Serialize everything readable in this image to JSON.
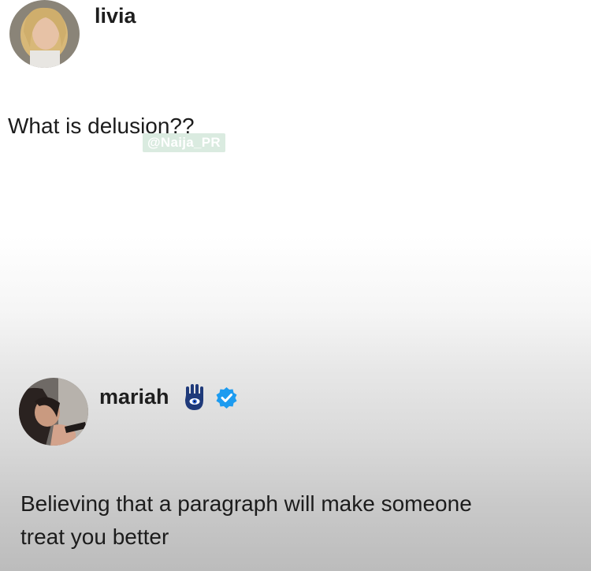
{
  "posts": [
    {
      "username": "livia",
      "text": "What is delusion??",
      "avatar_icon": "profile-photo-blonde-woman"
    },
    {
      "username": "mariah",
      "text_lines": [
        "Believing that a paragraph will make someone",
        "treat you better"
      ],
      "avatar_icon": "profile-photo-dark-haired-woman",
      "badges": [
        "hamsa-hand-icon",
        "verified-icon"
      ]
    }
  ],
  "watermark": "@Naija_PR",
  "colors": {
    "verified": "#1d9bf0",
    "hamsa": "#1f3a7a",
    "text": "#1c1c1c"
  }
}
